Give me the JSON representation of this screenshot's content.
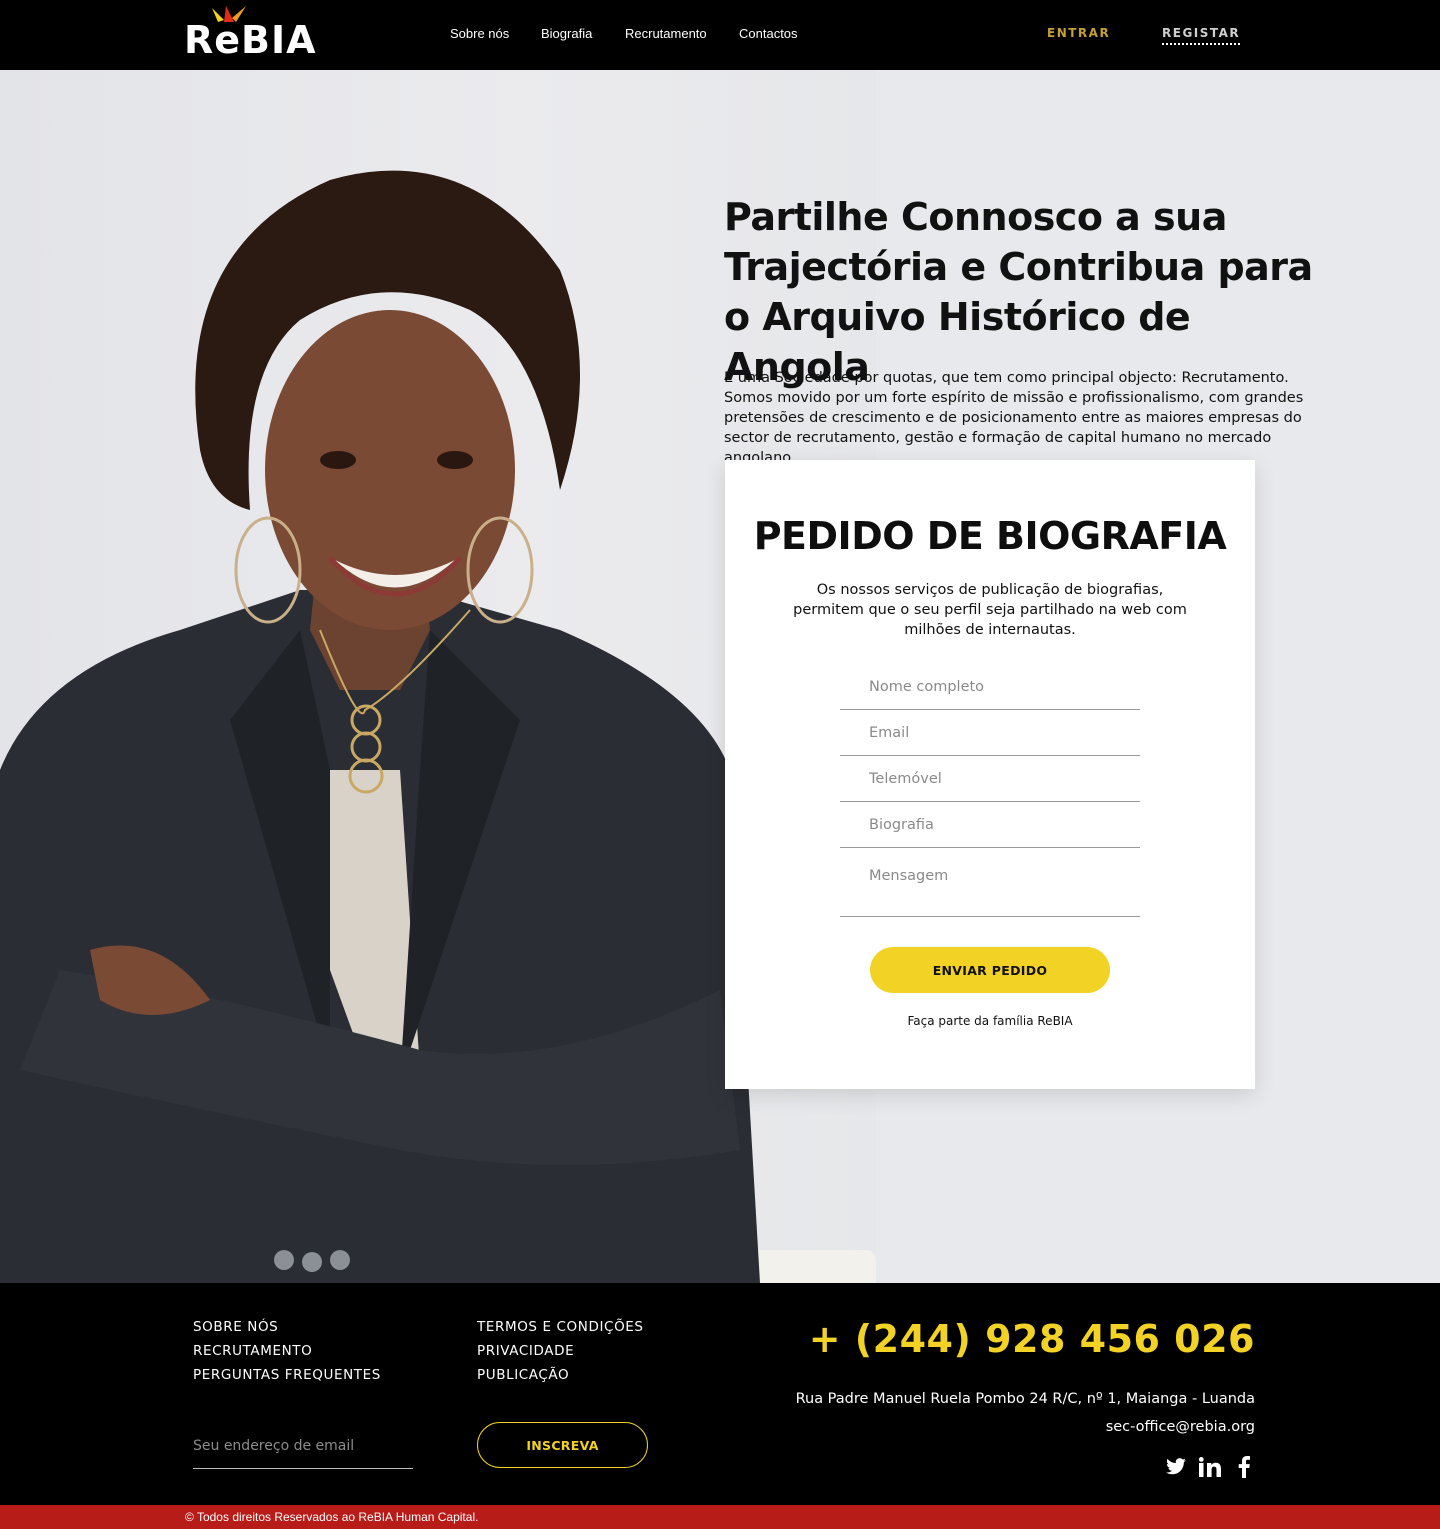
{
  "header": {
    "logo_text": "ReBIA",
    "nav": [
      "Sobre nós",
      "Biografia",
      "Recrutamento",
      "Contactos"
    ],
    "login_label": "ENTRAR",
    "register_label": "REGISTAR"
  },
  "hero": {
    "title": "Partilhe Connosco a sua Trajectória e Contribua para o Arquivo Histórico de Angola",
    "description": "É uma Sociedade por quotas, que tem como principal objecto: Recrutamento. Somos movido por um forte espírito de missão e profissionalismo, com grandes pretensões de crescimento e de posicionamento entre as maiores empresas do sector de recrutamento, gestão e formação de capital humano no mercado angolano."
  },
  "form": {
    "title": "PEDIDO DE BIOGRAFIA",
    "description": "Os nossos serviços de publicação de biografias, permitem que o seu perfil seja partilhado na web com milhões de internautas.",
    "name_placeholder": "Nome completo",
    "email_placeholder": "Email",
    "phone_placeholder": "Telemóvel",
    "bio_placeholder": "Biografia",
    "message_placeholder": "Mensagem",
    "submit_label": "ENVIAR PEDIDO",
    "footer_text": "Faça parte da família ReBIA"
  },
  "footer": {
    "links_col1": [
      "SOBRE NÓS",
      "RECRUTAMENTO",
      "PERGUNTAS FREQUENTES"
    ],
    "links_col2": [
      "TERMOS E CONDIÇÕES",
      "PRIVACIDADE",
      "PUBLICAÇÃO"
    ],
    "newsletter_placeholder": "Seu endereço de email",
    "subscribe_label": "INSCREVA",
    "phone": "+ (244) 928 456 026",
    "address": "Rua Padre Manuel Ruela Pombo 24 R/C, nº 1, Maianga - Luanda",
    "email": "sec-office@rebia.org",
    "socials": [
      "twitter-icon",
      "linkedin-icon",
      "facebook-icon"
    ],
    "copyright": "© Todos direitos Reservados ao ReBIA Human Capital."
  },
  "colors": {
    "accent_yellow": "#f2d224",
    "login_gold": "#c5a032",
    "header_bg": "#000000",
    "copyright_red": "#b71c18"
  }
}
